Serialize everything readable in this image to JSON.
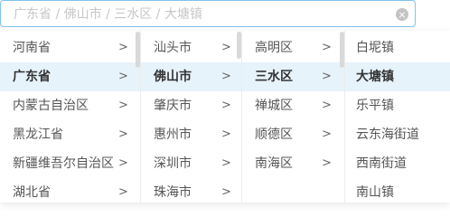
{
  "input": {
    "placeholder": "广东省 / 佛山市 / 三水区 / 大塘镇"
  },
  "columns": {
    "provinces": [
      {
        "label": "河南省",
        "arrow": ">"
      },
      {
        "label": "广东省",
        "arrow": ">"
      },
      {
        "label": "内蒙古自治区",
        "arrow": ">"
      },
      {
        "label": "黑龙江省",
        "arrow": ">"
      },
      {
        "label": "新疆维吾尔自治区",
        "arrow": ">"
      },
      {
        "label": "湖北省",
        "arrow": ">"
      }
    ],
    "cities": [
      {
        "label": "汕头市",
        "arrow": ">"
      },
      {
        "label": "佛山市",
        "arrow": ">"
      },
      {
        "label": "肇庆市",
        "arrow": ">"
      },
      {
        "label": "惠州市",
        "arrow": ">"
      },
      {
        "label": "深圳市",
        "arrow": ">"
      },
      {
        "label": "珠海市",
        "arrow": ">"
      }
    ],
    "districts": [
      {
        "label": "高明区",
        "arrow": ">"
      },
      {
        "label": "三水区",
        "arrow": ">"
      },
      {
        "label": "禅城区",
        "arrow": ">"
      },
      {
        "label": "顺德区",
        "arrow": ">"
      },
      {
        "label": "南海区",
        "arrow": ">"
      }
    ],
    "towns": [
      {
        "label": "白坭镇"
      },
      {
        "label": "大塘镇"
      },
      {
        "label": "乐平镇"
      },
      {
        "label": "云东海街道"
      },
      {
        "label": "西南街道"
      },
      {
        "label": "南山镇"
      }
    ]
  },
  "selected": {
    "province_index": 1,
    "city_index": 1,
    "district_index": 1,
    "town_index": 1
  },
  "colors": {
    "accent_border": "#7fc4ec",
    "active_row_bg": "#e7f3fb",
    "placeholder_text": "#c7c7c7"
  }
}
